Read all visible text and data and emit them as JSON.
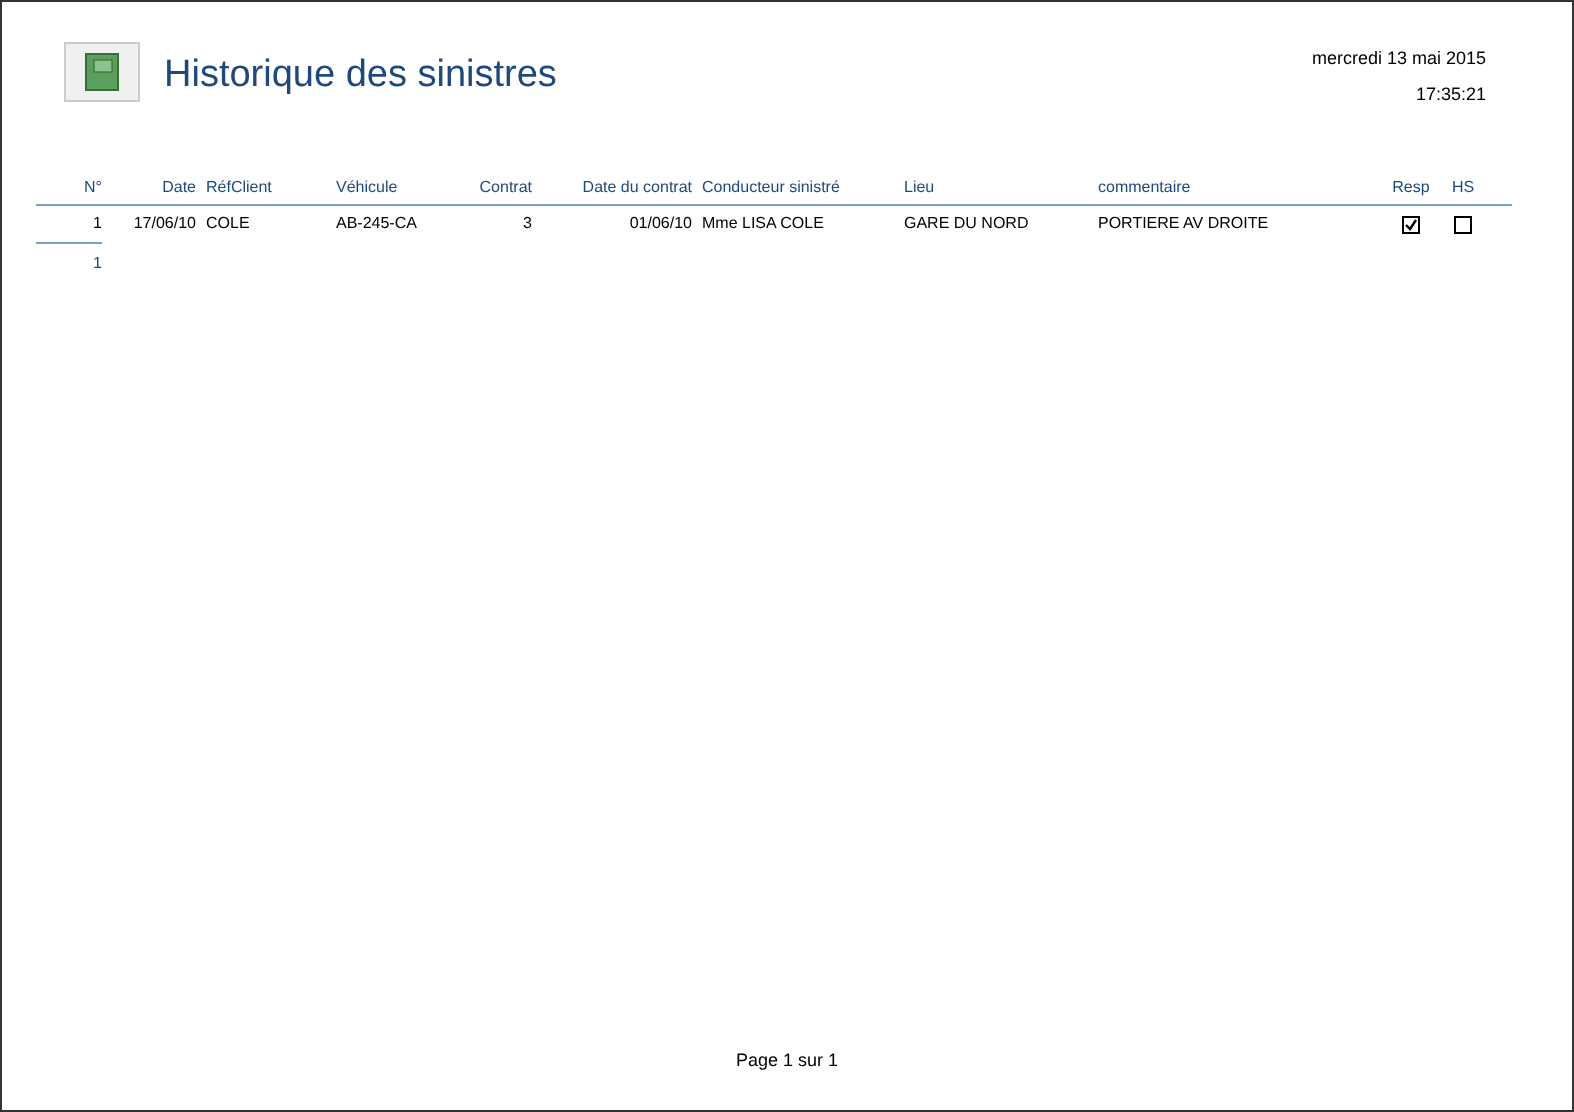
{
  "report": {
    "title": "Historique des sinistres",
    "date": "mercredi 13 mai 2015",
    "time": "17:35:21"
  },
  "table": {
    "columns": [
      "N°",
      "Date",
      "RéfClient",
      "Véhicule",
      "Contrat",
      "Date du contrat",
      "Conducteur sinistré",
      "Lieu",
      "commentaire",
      "Resp",
      "HS"
    ],
    "rows": [
      {
        "cells": [
          "1",
          "17/06/10",
          "COLE",
          "AB-245-CA",
          "3",
          "01/06/10",
          "Mme LISA COLE",
          "GARE DU NORD",
          "PORTIERE AV DROITE"
        ],
        "resp": true,
        "hs": false
      }
    ],
    "count": "1"
  },
  "footer": {
    "page": "Page 1 sur 1"
  }
}
